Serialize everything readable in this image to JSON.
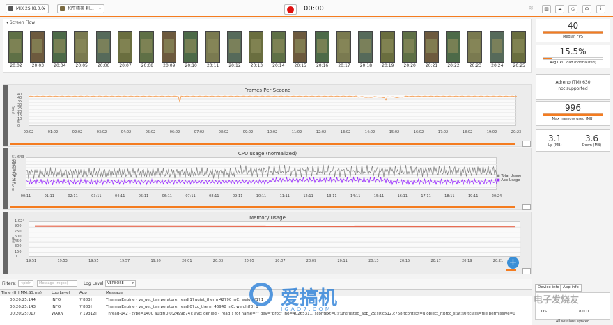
{
  "topbar": {
    "device": "MIX 2S (8.0.0)",
    "app": "和平精英 刺…",
    "timer": "00:00",
    "icons": [
      "wifi-icon",
      "trash-icon",
      "cloud-icon",
      "clock-icon",
      "settings-icon",
      "info-icon"
    ]
  },
  "screen_flow": {
    "title": "Screen Flow",
    "times": [
      "20:02",
      "20:03",
      "20:04",
      "20:05",
      "20:06",
      "20:07",
      "20:08",
      "20:09",
      "20:10",
      "20:11",
      "20:12",
      "20:13",
      "20:14",
      "20:15",
      "20:16",
      "20:17",
      "20:18",
      "20:19",
      "20:20",
      "20:21",
      "20:22",
      "20:23",
      "20:24",
      "20:25"
    ]
  },
  "fps_chart": {
    "title": "Frames Per Second",
    "ylabel": "FPS",
    "yticks": [
      "40.1",
      "40",
      "35",
      "30",
      "25",
      "20",
      "15",
      "10",
      "5",
      "0"
    ],
    "xticks": [
      "00:02",
      "01:02",
      "02:02",
      "03:02",
      "04:02",
      "05:02",
      "06:02",
      "07:02",
      "08:02",
      "09:02",
      "10:02",
      "11:02",
      "12:02",
      "13:02",
      "14:02",
      "15:02",
      "16:02",
      "17:02",
      "18:02",
      "19:02",
      "20:23"
    ]
  },
  "cpu_chart": {
    "title": "CPU usage (normalized)",
    "ylabel": "Usage (%)",
    "yticks": [
      "51.643",
      "45",
      "40",
      "35",
      "30",
      "25",
      "20",
      "15",
      "10",
      "5",
      "0"
    ],
    "xticks": [
      "00:11",
      "01:11",
      "02:11",
      "03:11",
      "04:11",
      "05:11",
      "06:11",
      "07:11",
      "08:11",
      "09:11",
      "10:11",
      "11:11",
      "12:11",
      "13:11",
      "14:11",
      "15:11",
      "16:11",
      "17:11",
      "18:11",
      "19:11",
      "20:24"
    ],
    "legend": [
      "Total Usage",
      "App Usage"
    ]
  },
  "mem_chart": {
    "title": "Memory usage",
    "ylabel": "MB",
    "yticks": [
      "1,024",
      "900",
      "750",
      "600",
      "450",
      "300",
      "150",
      "0"
    ],
    "xticks": [
      "19:51",
      "19:53",
      "19:55",
      "19:57",
      "19:59",
      "20:01",
      "20:03",
      "20:05",
      "20:07",
      "20:09",
      "20:11",
      "20:13",
      "20:15",
      "20:17",
      "20:19",
      "20:21"
    ]
  },
  "stats": {
    "median_fps": "40",
    "median_fps_label": "Median FPS",
    "cpu_load": "15.5%",
    "cpu_load_label": "Avg CPU load (normalized)",
    "gpu_name": "Adreno (TM) 630",
    "gpu_status": "not supported",
    "max_mem": "996",
    "max_mem_label": "Max memory used (MB)",
    "up": "3.1",
    "up_label": "Up (MB)",
    "down": "3.6",
    "down_label": "Down (MB)"
  },
  "filters": {
    "label": "Filters:",
    "pid_placeholder": "<pid>",
    "msg_placeholder": "Message (regex)",
    "level_label": "Log Level:",
    "level_value": "VERBOSE"
  },
  "log": {
    "headers": [
      "Time (HH:MM:SS.ms)",
      "Log Level",
      "App",
      "Message"
    ],
    "rows": [
      [
        "00:20:25:144",
        "INFO",
        "?[883]",
        "ThermalEngine - vs_get_temperature: read[1] quiet_therm 42790 mC, weight[1] 1"
      ],
      [
        "00:20:25:143",
        "INFO",
        "?[883]",
        "ThermalEngine - vs_get_temperature: read[0] xo_therm 46948 mC, weight[0] 1"
      ],
      [
        "00:20:25:017",
        "WARN",
        "?[19312]",
        "Thread-142 - type=1400 audit(0.0:2499874): avc: denied { read } for name=\"\" dev=\"proc\" ino=4026531... scontext=u:r:untrusted_app_25:s0:c512,c768 tcontext=u:object_r:proc_stat:s0 tclass=file permissive=0"
      ]
    ]
  },
  "side_tabs": [
    "Device info",
    "App info"
  ],
  "device_info": {
    "os_label": "OS",
    "os_value": "8.0.0",
    "synced": "All sessions synced"
  },
  "watermark": {
    "cn": "爱搞机",
    "url": "IGAO7.COM",
    "right": "电子发烧友"
  },
  "colors": {
    "accent": "#f47c20",
    "fps": "#f4a460",
    "total": "#888888",
    "app": "#9b30ff",
    "mem": "#e86a50"
  }
}
